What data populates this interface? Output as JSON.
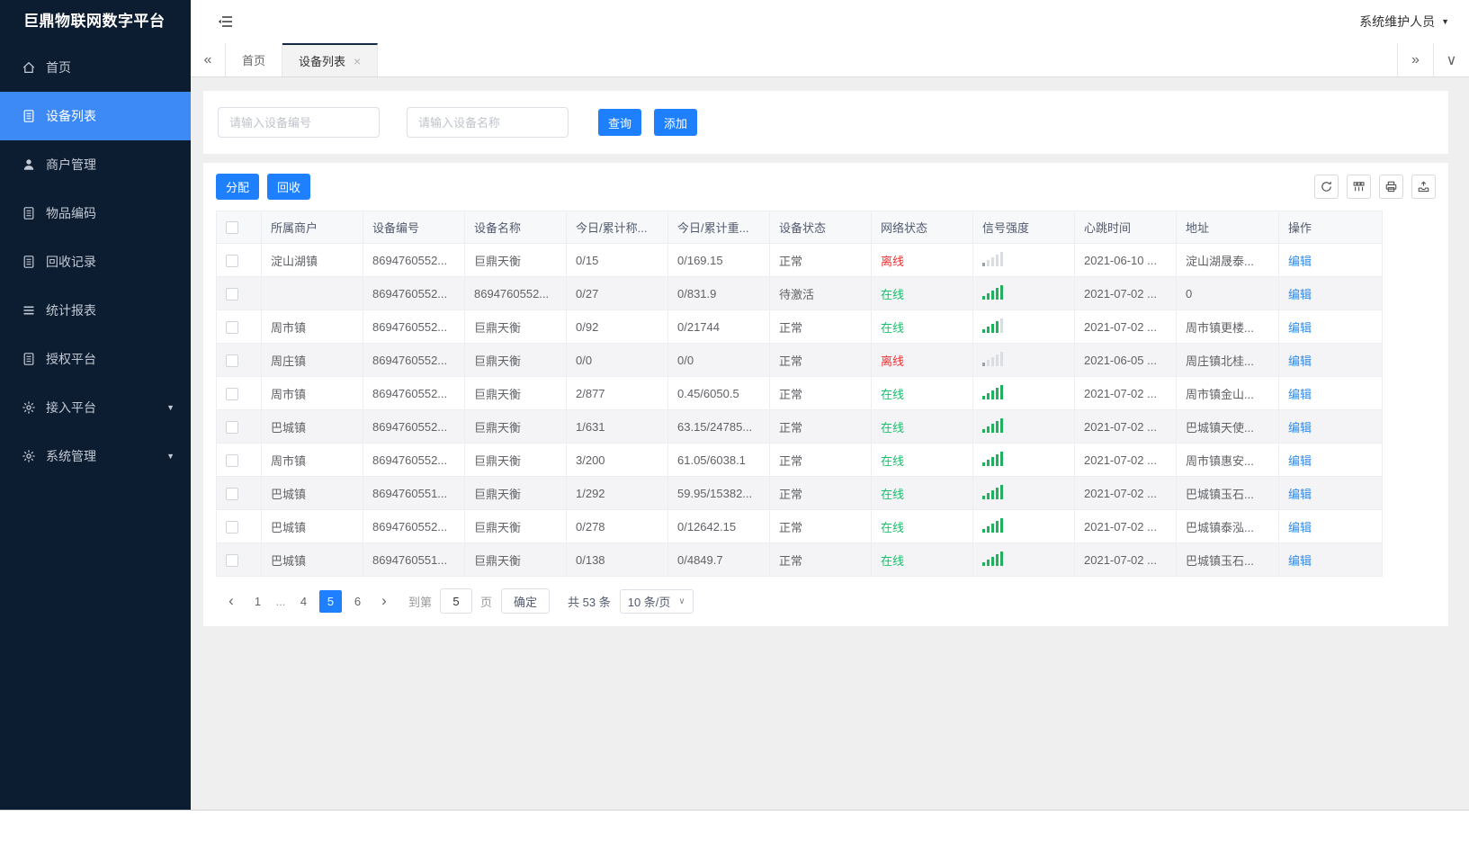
{
  "app": {
    "title": "巨鼎物联网数字平台"
  },
  "header": {
    "user_label": "系统维护人员"
  },
  "colors": {
    "sidebar_bg": "#0d1d31",
    "sidebar_active": "#3d8af7",
    "accent_blue": "#1e80ff",
    "link_blue": "#2d8cf0",
    "online_green": "#1cbe6e",
    "offline_red": "#f23030"
  },
  "sidebar": {
    "items": [
      {
        "key": "home",
        "label": "首页",
        "icon": "home-icon",
        "active": false,
        "expandable": false
      },
      {
        "key": "device-list",
        "label": "设备列表",
        "icon": "file-icon",
        "active": true,
        "expandable": false
      },
      {
        "key": "merchant-management",
        "label": "商户管理",
        "icon": "user-icon",
        "active": false,
        "expandable": false
      },
      {
        "key": "item-code",
        "label": "物品编码",
        "icon": "file-icon",
        "active": false,
        "expandable": false
      },
      {
        "key": "recycle-records",
        "label": "回收记录",
        "icon": "file-icon",
        "active": false,
        "expandable": false
      },
      {
        "key": "statistics-report",
        "label": "统计报表",
        "icon": "list-icon",
        "active": false,
        "expandable": false
      },
      {
        "key": "authorize-platform",
        "label": "授权平台",
        "icon": "file-icon",
        "active": false,
        "expandable": false
      },
      {
        "key": "access-platform",
        "label": "接入平台",
        "icon": "gear-icon",
        "active": false,
        "expandable": true
      },
      {
        "key": "system-management",
        "label": "系统管理",
        "icon": "gear-icon",
        "active": false,
        "expandable": true
      }
    ]
  },
  "tabs": {
    "items": [
      {
        "key": "home",
        "label": "首页",
        "active": false,
        "closable": false
      },
      {
        "key": "device-list",
        "label": "设备列表",
        "active": true,
        "closable": true
      }
    ]
  },
  "search": {
    "device_no_placeholder": "请输入设备编号",
    "device_name_placeholder": "请输入设备名称",
    "query_label": "查询",
    "add_label": "添加"
  },
  "toolbar": {
    "assign_label": "分配",
    "recycle_label": "回收",
    "icons": [
      "refresh-icon",
      "columns-icon",
      "print-icon",
      "export-icon"
    ]
  },
  "table": {
    "columns": [
      "",
      "所属商户",
      "设备编号",
      "设备名称",
      "今日/累计称...",
      "今日/累计重...",
      "设备状态",
      "网络状态",
      "信号强度",
      "心跳时间",
      "地址",
      "操作"
    ],
    "rows": [
      {
        "merchant": "淀山湖镇",
        "device_no": "8694760552...",
        "device_name": "巨鼎天衡",
        "today_count": "0/15",
        "today_weight": "0/169.15",
        "device_status": "正常",
        "network_status": "离线",
        "network_state": "offline",
        "signal_level": 1,
        "heartbeat": "2021-06-10 ...",
        "address": "淀山湖晟泰...",
        "action": "编辑"
      },
      {
        "merchant": "",
        "device_no": "8694760552...",
        "device_name": "8694760552...",
        "today_count": "0/27",
        "today_weight": "0/831.9",
        "device_status": "待激活",
        "network_status": "在线",
        "network_state": "online",
        "signal_level": 5,
        "heartbeat": "2021-07-02 ...",
        "address": "0",
        "action": "编辑"
      },
      {
        "merchant": "周市镇",
        "device_no": "8694760552...",
        "device_name": "巨鼎天衡",
        "today_count": "0/92",
        "today_weight": "0/21744",
        "device_status": "正常",
        "network_status": "在线",
        "network_state": "online",
        "signal_level": 4,
        "heartbeat": "2021-07-02 ...",
        "address": "周市镇更楼...",
        "action": "编辑"
      },
      {
        "merchant": "周庄镇",
        "device_no": "8694760552...",
        "device_name": "巨鼎天衡",
        "today_count": "0/0",
        "today_weight": "0/0",
        "device_status": "正常",
        "network_status": "离线",
        "network_state": "offline",
        "signal_level": 1,
        "heartbeat": "2021-06-05 ...",
        "address": "周庄镇北桂...",
        "action": "编辑"
      },
      {
        "merchant": "周市镇",
        "device_no": "8694760552...",
        "device_name": "巨鼎天衡",
        "today_count": "2/877",
        "today_weight": "0.45/6050.5",
        "device_status": "正常",
        "network_status": "在线",
        "network_state": "online",
        "signal_level": 5,
        "heartbeat": "2021-07-02 ...",
        "address": "周市镇金山...",
        "action": "编辑"
      },
      {
        "merchant": "巴城镇",
        "device_no": "8694760552...",
        "device_name": "巨鼎天衡",
        "today_count": "1/631",
        "today_weight": "63.15/24785...",
        "device_status": "正常",
        "network_status": "在线",
        "network_state": "online",
        "signal_level": 5,
        "heartbeat": "2021-07-02 ...",
        "address": "巴城镇天使...",
        "action": "编辑"
      },
      {
        "merchant": "周市镇",
        "device_no": "8694760552...",
        "device_name": "巨鼎天衡",
        "today_count": "3/200",
        "today_weight": "61.05/6038.1",
        "device_status": "正常",
        "network_status": "在线",
        "network_state": "online",
        "signal_level": 5,
        "heartbeat": "2021-07-02 ...",
        "address": "周市镇惠安...",
        "action": "编辑"
      },
      {
        "merchant": "巴城镇",
        "device_no": "8694760551...",
        "device_name": "巨鼎天衡",
        "today_count": "1/292",
        "today_weight": "59.95/15382...",
        "device_status": "正常",
        "network_status": "在线",
        "network_state": "online",
        "signal_level": 5,
        "heartbeat": "2021-07-02 ...",
        "address": "巴城镇玉石...",
        "action": "编辑"
      },
      {
        "merchant": "巴城镇",
        "device_no": "8694760552...",
        "device_name": "巨鼎天衡",
        "today_count": "0/278",
        "today_weight": "0/12642.15",
        "device_status": "正常",
        "network_status": "在线",
        "network_state": "online",
        "signal_level": 5,
        "heartbeat": "2021-07-02 ...",
        "address": "巴城镇泰泓...",
        "action": "编辑"
      },
      {
        "merchant": "巴城镇",
        "device_no": "8694760551...",
        "device_name": "巨鼎天衡",
        "today_count": "0/138",
        "today_weight": "0/4849.7",
        "device_status": "正常",
        "network_status": "在线",
        "network_state": "online",
        "signal_level": 5,
        "heartbeat": "2021-07-02 ...",
        "address": "巴城镇玉石...",
        "action": "编辑"
      }
    ]
  },
  "pagination": {
    "pages": [
      "1",
      "...",
      "4",
      "5",
      "6"
    ],
    "active_page": "5",
    "goto_label": "到第",
    "goto_value": "5",
    "page_unit": "页",
    "confirm_label": "确定",
    "total_label": "共 53 条",
    "page_size": "10 条/页"
  }
}
